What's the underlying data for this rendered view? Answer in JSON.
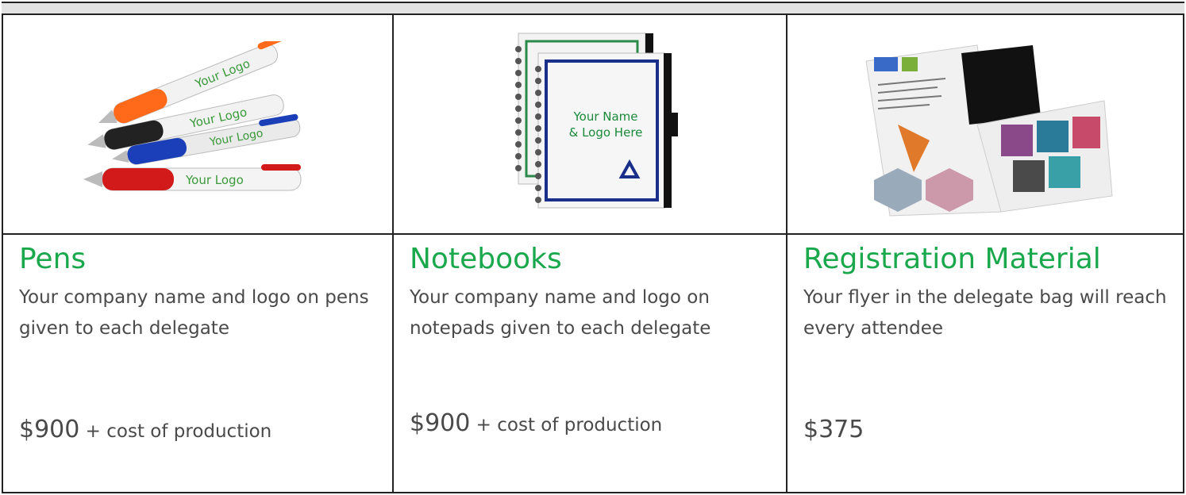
{
  "products": [
    {
      "title": "Pens",
      "description": "Your company name and logo on pens given to each delegate",
      "price_amount": "$900",
      "price_note": " + cost of production",
      "image": {
        "icon": "pens-image",
        "logo_text": "Your Logo"
      }
    },
    {
      "title": "Notebooks",
      "description": "Your company name and logo on notepads given to each delegate",
      "price_amount": "$900",
      "price_note": " + cost of production",
      "image": {
        "icon": "notebooks-image",
        "cover_line1": "Your Name",
        "cover_line2": "& Logo Here"
      }
    },
    {
      "title": "Registration Material",
      "description": "Your flyer in the delegate bag will reach every attendee",
      "price_amount": "$375",
      "price_note": "",
      "image": {
        "icon": "flyers-image"
      }
    }
  ],
  "colors": {
    "title": "#1aa84c",
    "text": "#4a4a4a",
    "border": "#222222",
    "header": "#e3e3e3"
  }
}
